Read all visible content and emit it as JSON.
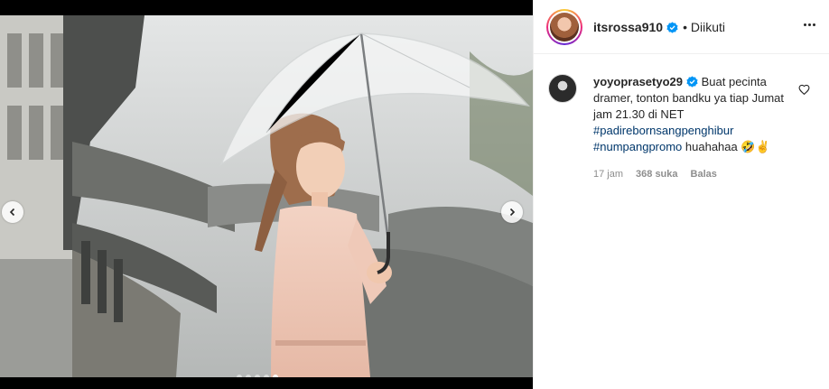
{
  "post": {
    "author": "itsrossa910",
    "separator": "•",
    "follow_status": "Diikuti",
    "carousel": {
      "total": 5,
      "active_index": 4
    }
  },
  "comment": {
    "username": "yoyoprasetyo29",
    "text": " Buat pecinta dramer, tonton bandku ya tiap Jumat jam 21.30 di NET ",
    "hashtag1": "#padirebornsangpenghibur",
    "hashtag2": "#numpangpromo",
    "tail": " huahahaa 🤣✌",
    "time": "17 jam",
    "likes": "368 suka",
    "reply": "Balas"
  },
  "colors": {
    "verified": "#0095f6",
    "hashtag": "#00376b",
    "meta": "#8e8e8e"
  },
  "icons": {
    "verified": "verified-badge-icon",
    "more": "more-options-icon",
    "like": "heart-icon",
    "prev": "chevron-left-icon",
    "next": "chevron-right-icon"
  }
}
